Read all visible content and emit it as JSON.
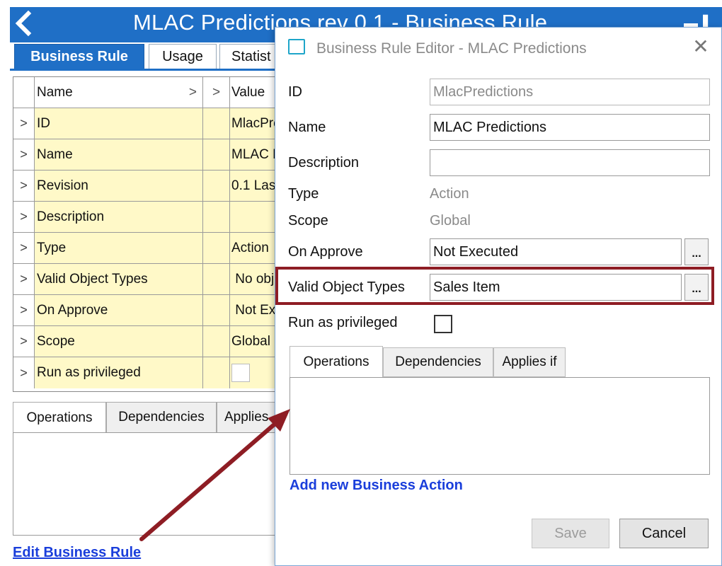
{
  "background_window": {
    "title": "MLAC Predictions rev 0.1 - Business Rule",
    "tabs": [
      "Business Rule",
      "Usage",
      "Statist"
    ],
    "grid": {
      "headers": {
        "name": "Name",
        "value": "Value"
      },
      "rows": [
        {
          "name": "ID",
          "value": "MlacPred"
        },
        {
          "name": "Name",
          "value": "MLAC Pr"
        },
        {
          "name": "Revision",
          "value": "0.1 Last"
        },
        {
          "name": "Description",
          "value": ""
        },
        {
          "name": "Type",
          "value": "Action"
        },
        {
          "name": "Valid Object Types",
          "value": " No obje"
        },
        {
          "name": "On Approve",
          "value": " Not Exe"
        },
        {
          "name": "Scope",
          "value": "Global"
        },
        {
          "name": "Run as privileged",
          "value": ""
        }
      ]
    },
    "bottom_tabs": [
      "Operations",
      "Dependencies",
      "Applies"
    ],
    "edit_link": "Edit Business Rule"
  },
  "dialog": {
    "title": "Business Rule Editor - MLAC Predictions",
    "fields": {
      "id": {
        "label": "ID",
        "value": "MlacPredictions"
      },
      "name": {
        "label": "Name",
        "value": "MLAC Predictions"
      },
      "description": {
        "label": "Description",
        "value": ""
      },
      "type": {
        "label": "Type",
        "value": "Action"
      },
      "scope": {
        "label": "Scope",
        "value": "Global"
      },
      "on_approve": {
        "label": "On Approve",
        "value": "Not Executed"
      },
      "valid_object_types": {
        "label": "Valid Object Types",
        "value": "Sales Item"
      },
      "run_as_privileged": {
        "label": "Run as privileged",
        "checked": false
      }
    },
    "ellipsis_label": "...",
    "tabs": [
      "Operations",
      "Dependencies",
      "Applies if"
    ],
    "add_action_link": "Add new Business Action",
    "buttons": {
      "save": "Save",
      "cancel": "Cancel"
    }
  },
  "colors": {
    "titlebar_blue": "#1f6fc6",
    "grid_yellow": "#fff9c8",
    "highlight_red": "#8e1d24",
    "link_blue": "#1a3edb"
  },
  "icons": [
    "back-chevron-icon",
    "window-icon",
    "close-icon",
    "expand-chevron-icon"
  ]
}
